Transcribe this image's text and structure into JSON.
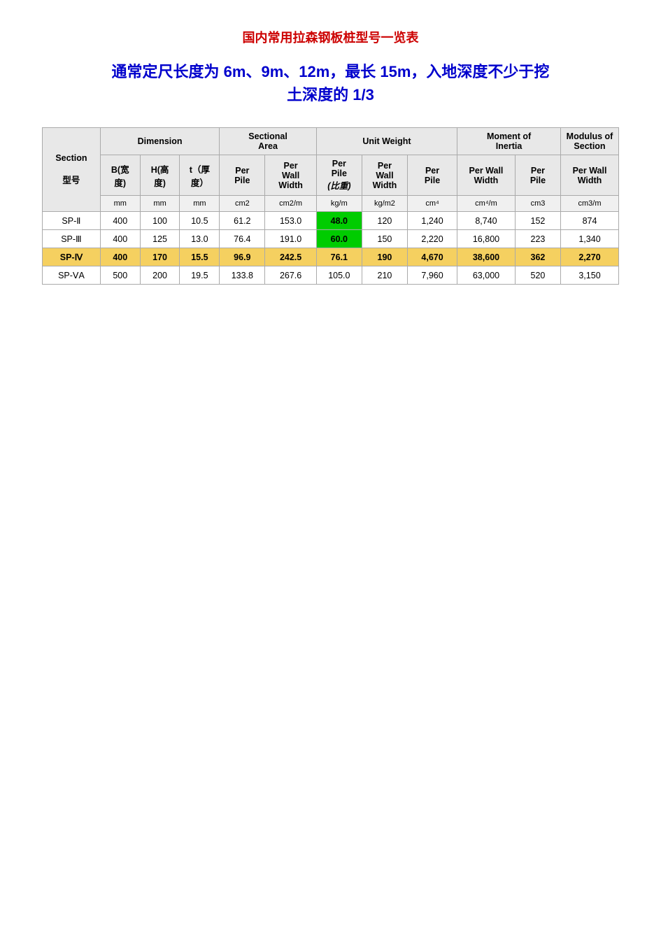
{
  "page": {
    "title": "国内常用拉森钢板桩型号一览表",
    "subtitle_line1": "通常定尺长度为 6m、9m、12m，最长 15m，入地深度不少于挖",
    "subtitle_line2": "土深度的 1/3"
  },
  "table": {
    "col_groups": [
      {
        "label": "Dimension",
        "colspan": 3
      },
      {
        "label": "Sectional Area",
        "colspan": 2
      },
      {
        "label": "Unit Weight",
        "colspan": 3
      },
      {
        "label": "Moment of Inertia",
        "colspan": 2
      },
      {
        "label": "Modulus of Section",
        "colspan": 2
      }
    ],
    "subheaders": [
      {
        "label": "B(宽度)"
      },
      {
        "label": "H(高度)"
      },
      {
        "label": "t（厚度）"
      },
      {
        "label": "Per Pile"
      },
      {
        "label": "Per Wall Width"
      },
      {
        "label": "Per Pile (比重)"
      },
      {
        "label": "Per Wall Width"
      },
      {
        "label": "Per Pile"
      },
      {
        "label": "Per Wall Width"
      },
      {
        "label": "Per Pile"
      },
      {
        "label": "Per Wall Width"
      }
    ],
    "units": [
      "mm",
      "mm",
      "mm",
      "cm2",
      "cm2/m",
      "kg/m",
      "kg/m2",
      "cm⁴",
      "cm⁴/m",
      "cm3",
      "cm3/m"
    ],
    "rows": [
      {
        "section": "SP-Ⅱ",
        "b": "400",
        "h": "100",
        "t": "10.5",
        "per_pile_area": "61.2",
        "per_wall_area": "153.0",
        "per_pile_weight": "48.0",
        "per_wall_weight": "120",
        "per_pile_inertia": "1,240",
        "per_wall_inertia": "8,740",
        "per_pile_modulus": "152",
        "per_wall_modulus": "874",
        "highlight_weight": true
      },
      {
        "section": "SP-Ⅲ",
        "b": "400",
        "h": "125",
        "t": "13.0",
        "per_pile_area": "76.4",
        "per_wall_area": "191.0",
        "per_pile_weight": "60.0",
        "per_wall_weight": "150",
        "per_pile_inertia": "2,220",
        "per_wall_inertia": "16,800",
        "per_pile_modulus": "223",
        "per_wall_modulus": "1,340",
        "highlight_weight": true
      },
      {
        "section": "SP-Ⅳ",
        "b": "400",
        "h": "170",
        "t": "15.5",
        "per_pile_area": "96.9",
        "per_wall_area": "242.5",
        "per_pile_weight": "76.1",
        "per_wall_weight": "190",
        "per_pile_inertia": "4,670",
        "per_wall_inertia": "38,600",
        "per_pile_modulus": "362",
        "per_wall_modulus": "2,270",
        "highlight_row": true,
        "highlight_weight": false
      },
      {
        "section": "SP-ⅤA",
        "b": "500",
        "h": "200",
        "t": "19.5",
        "per_pile_area": "133.8",
        "per_wall_area": "267.6",
        "per_pile_weight": "105.0",
        "per_wall_weight": "210",
        "per_pile_inertia": "7,960",
        "per_wall_inertia": "63,000",
        "per_pile_modulus": "520",
        "per_wall_modulus": "3,150",
        "highlight_weight": false
      }
    ]
  }
}
